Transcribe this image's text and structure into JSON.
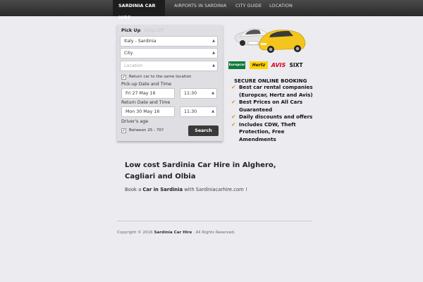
{
  "nav": {
    "items": [
      {
        "label": "SARDINIA CAR HIRE",
        "active": true
      },
      {
        "label": "AIRPORTS IN SARDINIA"
      },
      {
        "label": "CITY GUIDE"
      },
      {
        "label": "LOCATION"
      }
    ]
  },
  "form": {
    "tab_pickup": "Pick Up",
    "tab_dropoff": "Drop Off",
    "country_select": "Italy - Sardinia",
    "city_select": "City",
    "location_placeholder": "Location",
    "return_same_label": "Return car to the same location",
    "return_same_checked": true,
    "pickup_label": "Pick-up Date and Time",
    "pickup_date": "Fri 27 May 16",
    "pickup_time": "11:30",
    "return_label": "Return Date and Time",
    "return_date": "Mon 30 May 16",
    "return_time": "11:30",
    "drivers_age_label": "Driver's age",
    "age_range_label": "Between 25 - 70?",
    "age_checked": true,
    "search_button": "Search"
  },
  "brands": {
    "europcar": "Europcar",
    "hertz": "Hertz",
    "avis": "AVIS",
    "sixt": "SIXT"
  },
  "booking": {
    "title": "SECURE ONLINE BOOKING",
    "items": [
      "Best car rental companies (Europcar, Hertz and Avis)",
      "Best Prices on All Cars Guaranteed",
      "Daily discounts and offers",
      "Includes CDW, Theft Protection, Free Amendments"
    ]
  },
  "content": {
    "headline": "Low cost Sardinia Car Hire in Alghero, Cagliari and Olbia",
    "para_prefix": "Book a",
    "para_bold": "Car in Sardinia",
    "para_suffix": "with Sardiniacarhire.com !"
  },
  "footer": {
    "copyright_prefix": "Copyright © 2016",
    "brand": "Sardinia Car Hire",
    "suffix": ". All Rights Reserved."
  },
  "colors": {
    "accent_orange": "#e08a1e",
    "navbar": "#2a2a2a",
    "background": "#ebebf0"
  }
}
